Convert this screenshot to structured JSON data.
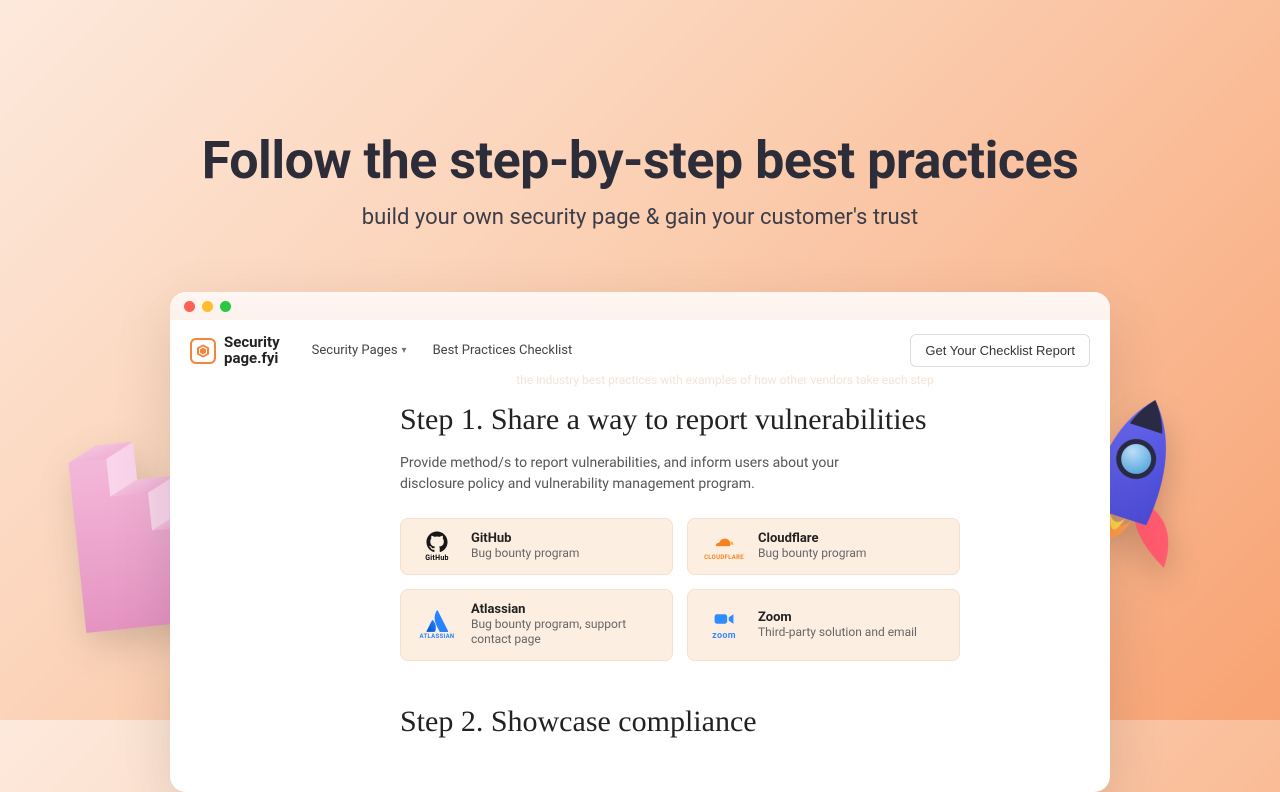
{
  "hero": {
    "title": "Follow the step-by-step best practices",
    "subtitle": "build your own security page & gain your customer's trust"
  },
  "brand": {
    "line1": "Security",
    "line2": "page.fyi"
  },
  "nav": {
    "item1": "Security Pages",
    "item2": "Best Practices Checklist",
    "cta": "Get Your Checklist Report"
  },
  "intro_faint": "the industry best practices with examples of how other vendors take each step",
  "step1": {
    "title": "Step 1. Share a way to report vulnerabilities",
    "desc": "Provide method/s to report vulnerabilities, and inform users about your disclosure policy and vulnerability management program.",
    "cards": [
      {
        "name": "GitHub",
        "sub": "Bug bounty program",
        "logo_word": "GitHub",
        "logo_color": "#181717"
      },
      {
        "name": "Cloudflare",
        "sub": "Bug bounty program",
        "logo_word": "CLOUDFLARE",
        "logo_color": "#f6821f"
      },
      {
        "name": "Atlassian",
        "sub": "Bug bounty program, support contact page",
        "logo_word": "ATLASSIAN",
        "logo_color": "#2684ff"
      },
      {
        "name": "Zoom",
        "sub": "Third-party solution and email",
        "logo_word": "zoom",
        "logo_color": "#2d8cff"
      }
    ]
  },
  "step2": {
    "title": "Step 2. Showcase compliance"
  }
}
